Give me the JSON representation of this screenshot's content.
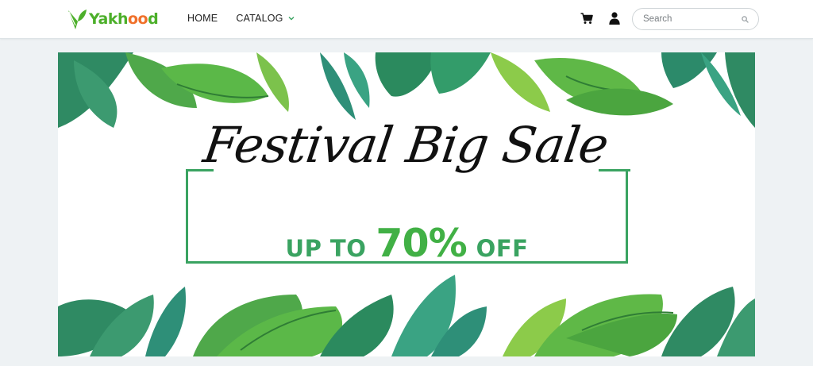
{
  "brand": {
    "logo_icon": "leaf-logo-icon",
    "name_prefix": "Yakh",
    "name_accent": "oo",
    "name_suffix": "d"
  },
  "nav": {
    "home": "HOME",
    "catalog": "CATALOG",
    "catalog_icon": "chevron-down-icon"
  },
  "actions": {
    "cart_icon": "cart-icon",
    "account_icon": "user-icon"
  },
  "search": {
    "placeholder": "Search",
    "value": "",
    "icon": "search-icon"
  },
  "banner": {
    "headline": "Festival Big Sale",
    "offer_prefix": "UP TO",
    "offer_value": "70%",
    "offer_suffix": "OFF",
    "decor": "tropical-leaves"
  },
  "colors": {
    "brand_green": "#4caf2a",
    "brand_orange": "#f0702a",
    "offer_green": "#3aa361",
    "page_bg": "#eef2f4"
  }
}
